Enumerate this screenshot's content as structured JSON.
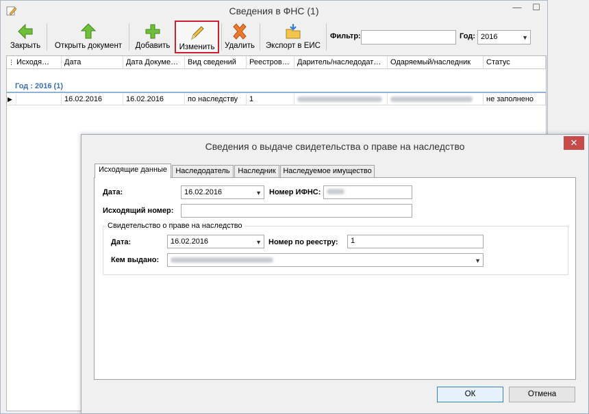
{
  "main_window": {
    "title": "Сведения в ФНС (1)",
    "controls": {
      "minimize": "—",
      "maximize": "☐"
    }
  },
  "toolbar": {
    "close_label": "Закрыть",
    "open_label": "Открыть документ",
    "add_label": "Добавить",
    "edit_label": "Изменить",
    "delete_label": "Удалить",
    "export_label": "Экспорт в ЕИС",
    "filter_label": "Фильтр:",
    "filter_value": "",
    "year_label": "Год:",
    "year_value": "2016"
  },
  "grid": {
    "columns": [
      "Исходя…",
      "Дата",
      "Дата Докуме…",
      "Вид сведений",
      "Реестров…",
      "Даритель/наследодат…",
      "Одаряемый/наследник",
      "Статус"
    ],
    "group_label": "Год : 2016 (1)",
    "rows": [
      {
        "date": "16.02.2016",
        "doc_date": "16.02.2016",
        "kind": "по наследству",
        "registry": "1",
        "status": "не заполнено"
      }
    ]
  },
  "dialog": {
    "title": "Сведения о выдаче свидетельства о праве на наследство",
    "close": "✕",
    "tabs": [
      "Исходящие данные",
      "Наследодатель",
      "Наследник",
      "Наследуемое имущество"
    ],
    "date_label": "Дата:",
    "date_value": "16.02.2016",
    "ifns_label": "Номер ИФНС:",
    "outgoing_label": "Исходящий номер:",
    "outgoing_value": "",
    "group_title": "Свидетельство о праве на наследство",
    "cert_date_label": "Дата:",
    "cert_date_value": "16.02.2016",
    "registry_label": "Номер по реестру:",
    "registry_value": "1",
    "issued_by_label": "Кем выдано:",
    "ok_label": "ОК",
    "cancel_label": "Отмена"
  }
}
